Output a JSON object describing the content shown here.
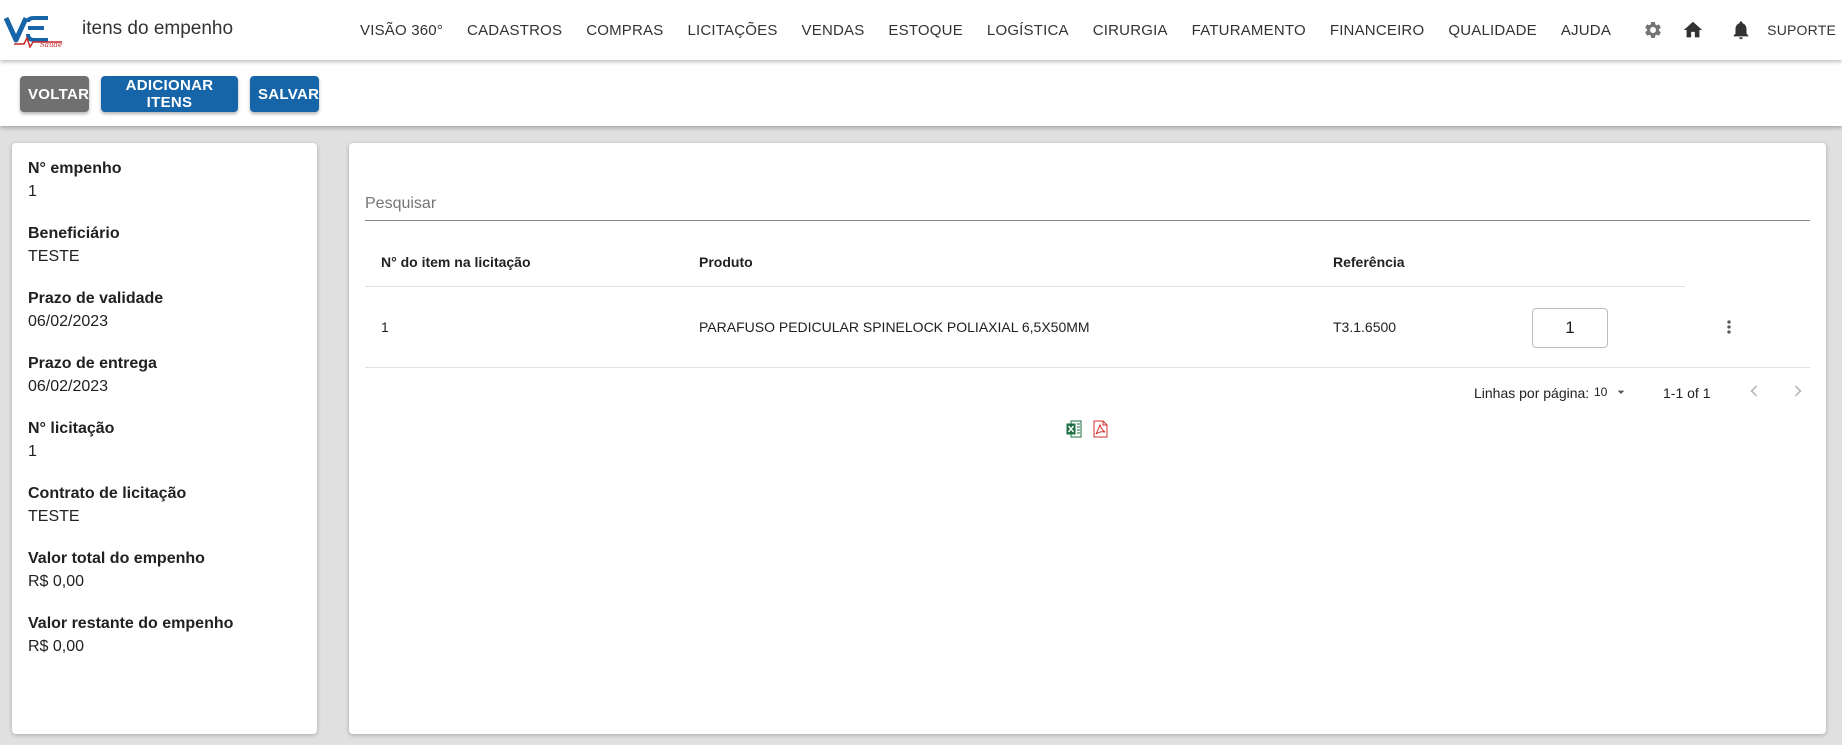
{
  "app": {
    "logo_icon": "vs-saude-logo-icon",
    "title": "itens do empenho"
  },
  "nav": {
    "items": [
      "VISÃO 360°",
      "CADASTROS",
      "COMPRAS",
      "LICITAÇÕES",
      "VENDAS",
      "ESTOQUE",
      "LOGÍSTICA",
      "CIRURGIA",
      "FATURAMENTO",
      "FINANCEIRO",
      "QUALIDADE",
      "AJUDA"
    ],
    "settings_icon": "gear-icon"
  },
  "header_right": {
    "home_icon": "home-icon",
    "notifications_icon": "bell-icon",
    "user": "SUPORTE"
  },
  "toolbar": {
    "back_label": "VOLTAR",
    "add_label": "ADICIONAR ITENS",
    "save_label": "SALVAR"
  },
  "details": [
    {
      "label": "N° empenho",
      "value": "1"
    },
    {
      "label": "Beneficiário",
      "value": "TESTE"
    },
    {
      "label": "Prazo de validade",
      "value": "06/02/2023"
    },
    {
      "label": "Prazo de entrega",
      "value": "06/02/2023"
    },
    {
      "label": "N° licitação",
      "value": "1"
    },
    {
      "label": "Contrato de licitação",
      "value": "TESTE"
    },
    {
      "label": "Valor total do empenho",
      "value": "R$ 0,00"
    },
    {
      "label": "Valor restante do empenho",
      "value": "R$ 0,00"
    }
  ],
  "search": {
    "placeholder": "Pesquisar",
    "value": ""
  },
  "table": {
    "headers": [
      "N° do item na licitação",
      "Produto",
      "Referência"
    ],
    "rows": [
      {
        "item": "1",
        "produto": "PARAFUSO PEDICULAR SPINELOCK POLIAXIAL 6,5X50MM",
        "referencia": "T3.1.6500",
        "quantidade": "1",
        "menu_icon": "more-vert-icon"
      }
    ]
  },
  "pagination": {
    "rows_per_page_label": "Linhas por página:",
    "rows_per_page": "10",
    "range": "1-1 of 1",
    "prev_icon": "chevron-left-icon",
    "next_icon": "chevron-right-icon"
  },
  "export": {
    "excel_icon": "excel-icon",
    "pdf_icon": "pdf-icon"
  },
  "colors": {
    "primary": "#1565a8",
    "secondary_button": "#707070",
    "background": "#e0e0e0",
    "excel": "#1d6f42",
    "pdf": "#d32f2f",
    "logo_blue": "#1565a8",
    "logo_red": "#c62828"
  }
}
